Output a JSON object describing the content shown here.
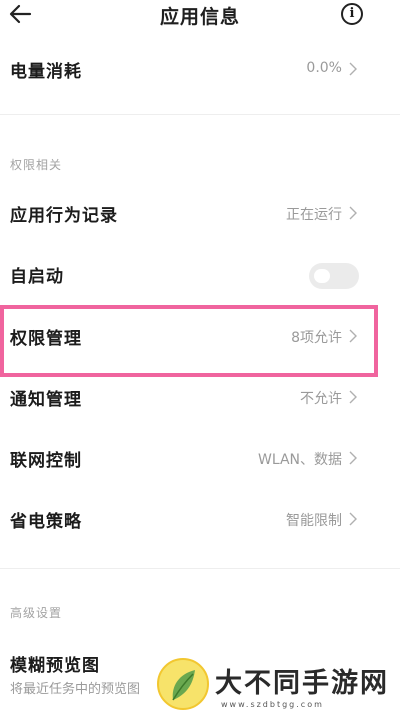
{
  "header": {
    "title": "应用信息",
    "back_icon": "arrow-left-icon",
    "info_icon": "info-icon",
    "info_glyph": "i"
  },
  "battery": {
    "label": "电量消耗",
    "value": "0.0%"
  },
  "sections": {
    "permissions": "权限相关",
    "advanced": "高级设置"
  },
  "rows": [
    {
      "label": "应用行为记录",
      "value": "正在运行"
    },
    {
      "label": "自启动",
      "value": "",
      "toggle_on": false
    },
    {
      "label": "权限管理",
      "value": "8项允许"
    },
    {
      "label": "通知管理",
      "value": "不允许"
    },
    {
      "label": "联网控制",
      "value": "WLAN、数据"
    },
    {
      "label": "省电策略",
      "value": "智能限制"
    }
  ],
  "blur_preview": {
    "label": "模糊预览图",
    "subtitle": "将最近任务中的预览图"
  },
  "highlight_color": "#f0649e",
  "watermark": {
    "text": "大不同手游网",
    "url": "www.szdbtgg.com"
  }
}
